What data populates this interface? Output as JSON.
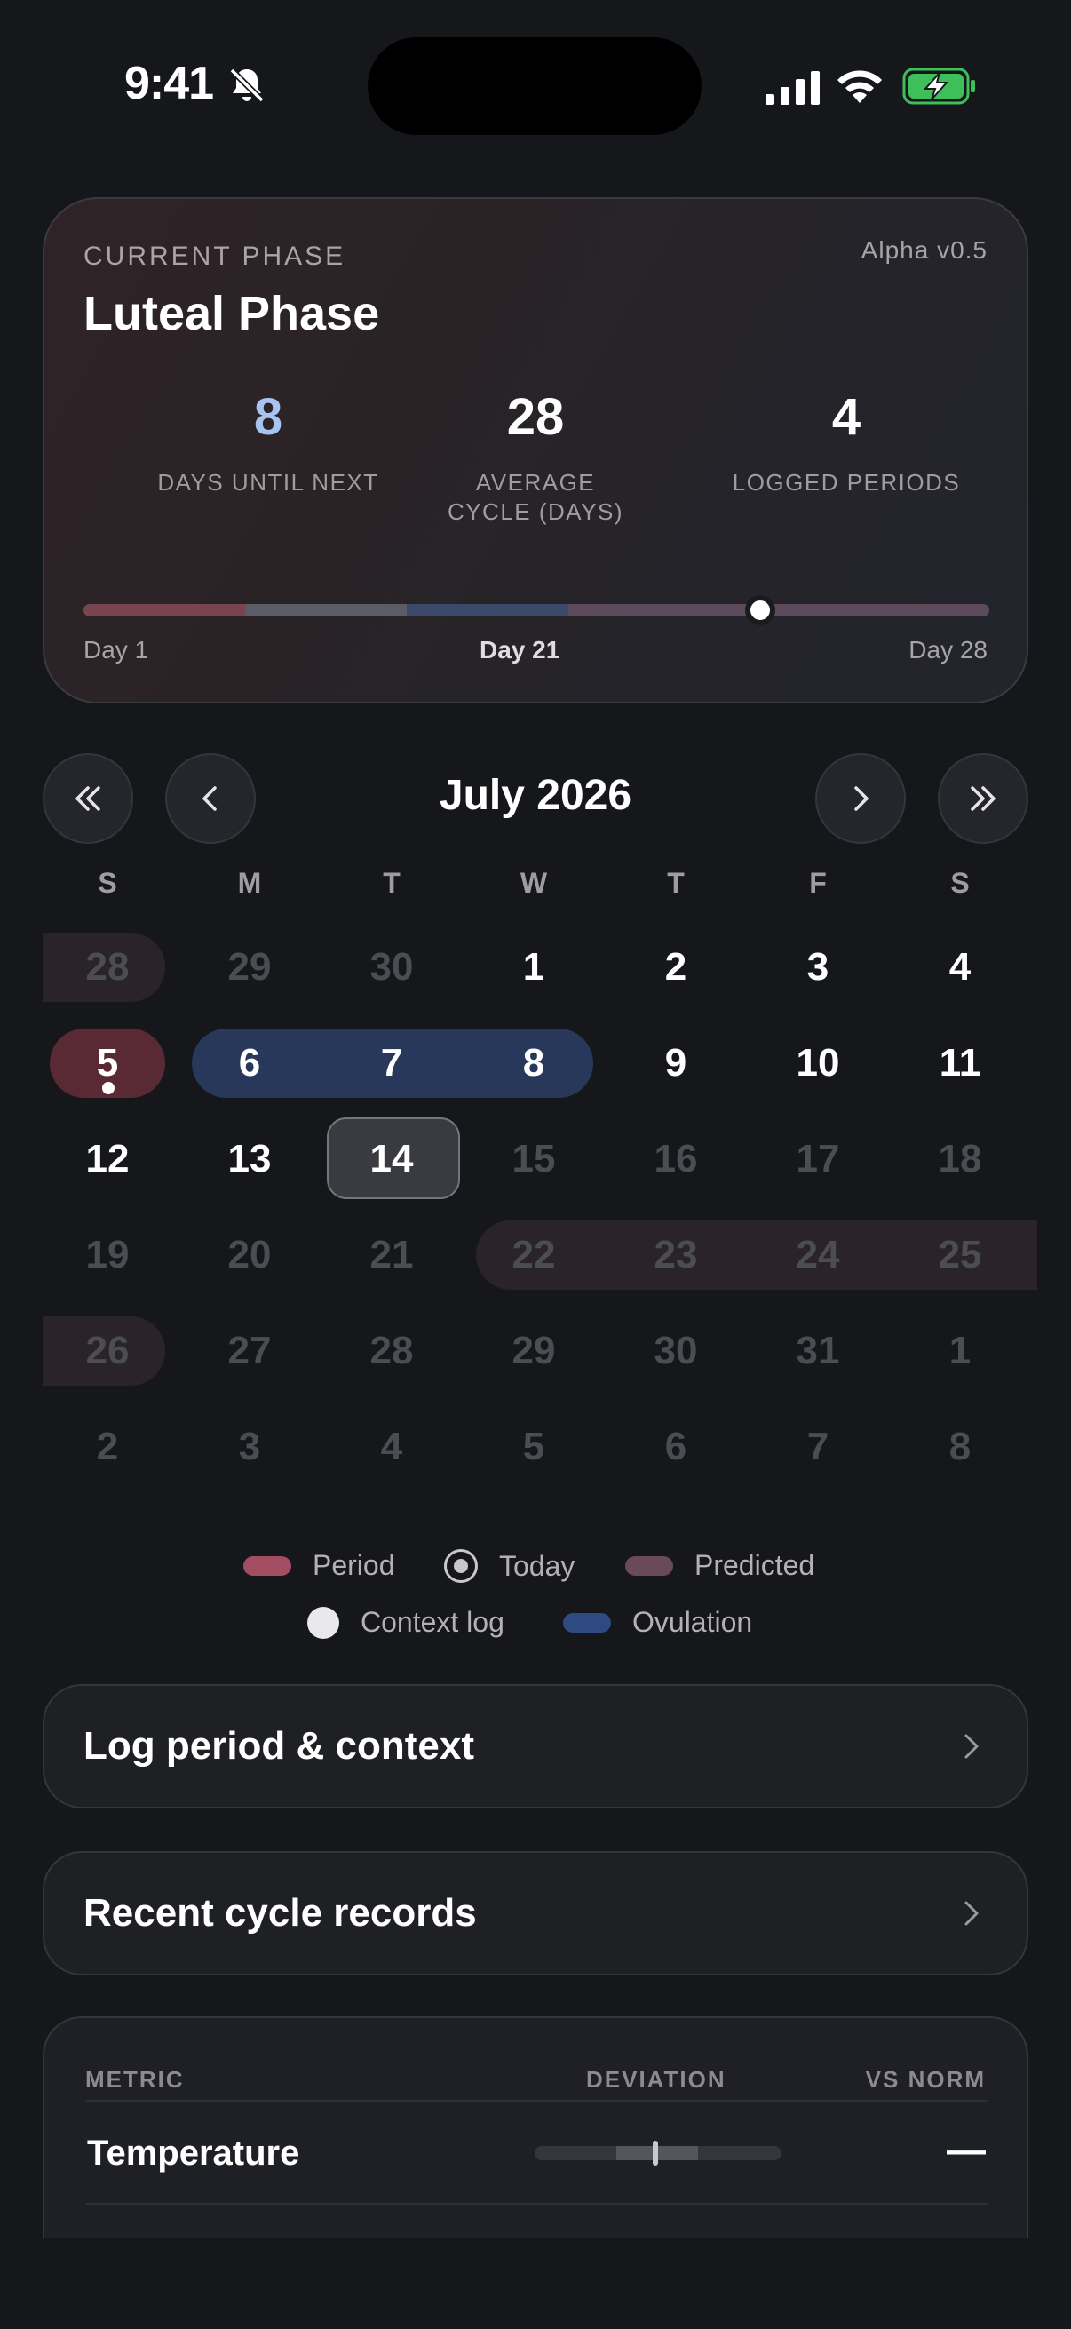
{
  "status_bar": {
    "time": "9:41"
  },
  "phase_card": {
    "label": "CURRENT PHASE",
    "version": "Alpha v0.5",
    "title": "Luteal Phase",
    "stats": [
      {
        "value": "8",
        "caption": "DAYS UNTIL NEXT"
      },
      {
        "value": "28",
        "caption": "AVERAGE CYCLE (DAYS)"
      },
      {
        "value": "4",
        "caption": "LOGGED PERIODS"
      }
    ],
    "progress": {
      "start": "Day 1",
      "current": "Day 21",
      "end": "Day 28",
      "current_day": 21,
      "total_days": 28
    }
  },
  "calendar": {
    "month_title": "July 2026",
    "weekdays": [
      "S",
      "M",
      "T",
      "W",
      "T",
      "F",
      "S"
    ],
    "weeks": [
      [
        "28",
        "29",
        "30",
        "1",
        "2",
        "3",
        "4"
      ],
      [
        "5",
        "6",
        "7",
        "8",
        "9",
        "10",
        "11"
      ],
      [
        "12",
        "13",
        "14",
        "15",
        "16",
        "17",
        "18"
      ],
      [
        "19",
        "20",
        "21",
        "22",
        "23",
        "24",
        "25"
      ],
      [
        "26",
        "27",
        "28",
        "29",
        "30",
        "31",
        "1"
      ],
      [
        "2",
        "3",
        "4",
        "5",
        "6",
        "7",
        "8"
      ]
    ],
    "colors": {
      "period": "#5a2a34",
      "ovulation": "#27385a",
      "predicted": "#2a2428"
    }
  },
  "legend": {
    "period": "Period",
    "today": "Today",
    "predicted": "Predicted",
    "context_log": "Context log",
    "ovulation": "Ovulation"
  },
  "actions": {
    "log_period": "Log period & context",
    "recent_records": "Recent cycle records"
  },
  "metrics": {
    "headers": {
      "metric": "METRIC",
      "deviation": "DEVIATION",
      "vs_norm": "VS NORM"
    },
    "rows": [
      {
        "name": "Temperature",
        "vs_norm": "—"
      }
    ]
  }
}
